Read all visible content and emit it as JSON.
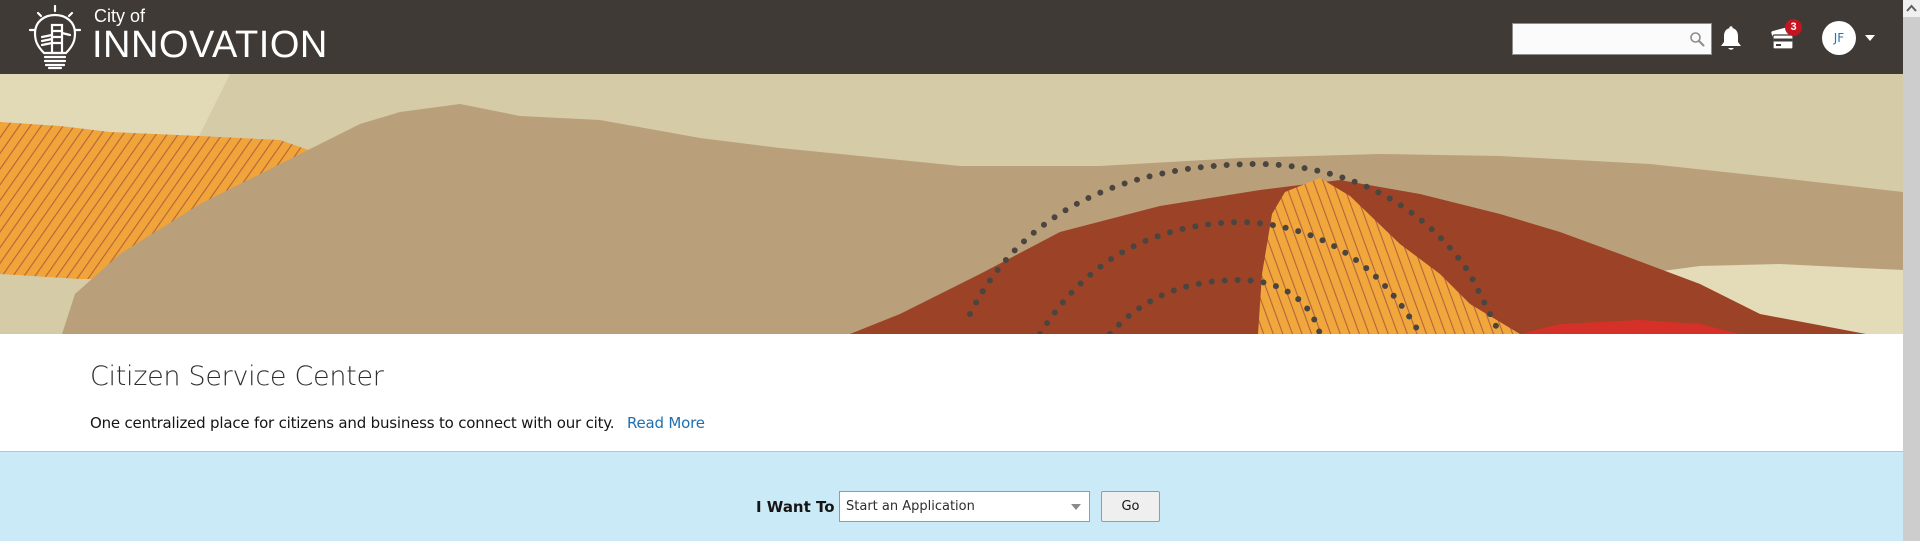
{
  "header": {
    "logo": {
      "icon": "lightbulb-city-icon",
      "small_text": "City of",
      "big_text": "INNOVATION"
    },
    "search": {
      "value": "",
      "placeholder": "",
      "icon": "search-icon"
    },
    "notifications": {
      "icon": "bell-icon"
    },
    "cart": {
      "icon": "payment-cards-icon",
      "badge_count": "3"
    },
    "user": {
      "initials": "JF",
      "menu_icon": "caret-down-icon"
    }
  },
  "banner": {
    "description": "Decorative landscape illustration with torn-paper hills",
    "colors": {
      "sky": "#d5cba6",
      "sand": "#b79f76",
      "orange": "#f0a43a",
      "rust": "#9b3f23",
      "red": "#d63128",
      "cream": "#e4dbb8",
      "dots": "#4b4540"
    }
  },
  "intro": {
    "title": "Citizen Service Center",
    "description": "One centralized place for citizens and business to connect with our city.",
    "link_label": "Read More"
  },
  "want_to": {
    "label": "I Want To",
    "select_value": "Start an Application",
    "go_label": "Go"
  },
  "colors": {
    "header_bg": "#3f3a36",
    "link": "#1f6fb0",
    "band_bg": "#cbeaf7",
    "badge": "#c5141f",
    "avatar_text": "#2775b6"
  }
}
